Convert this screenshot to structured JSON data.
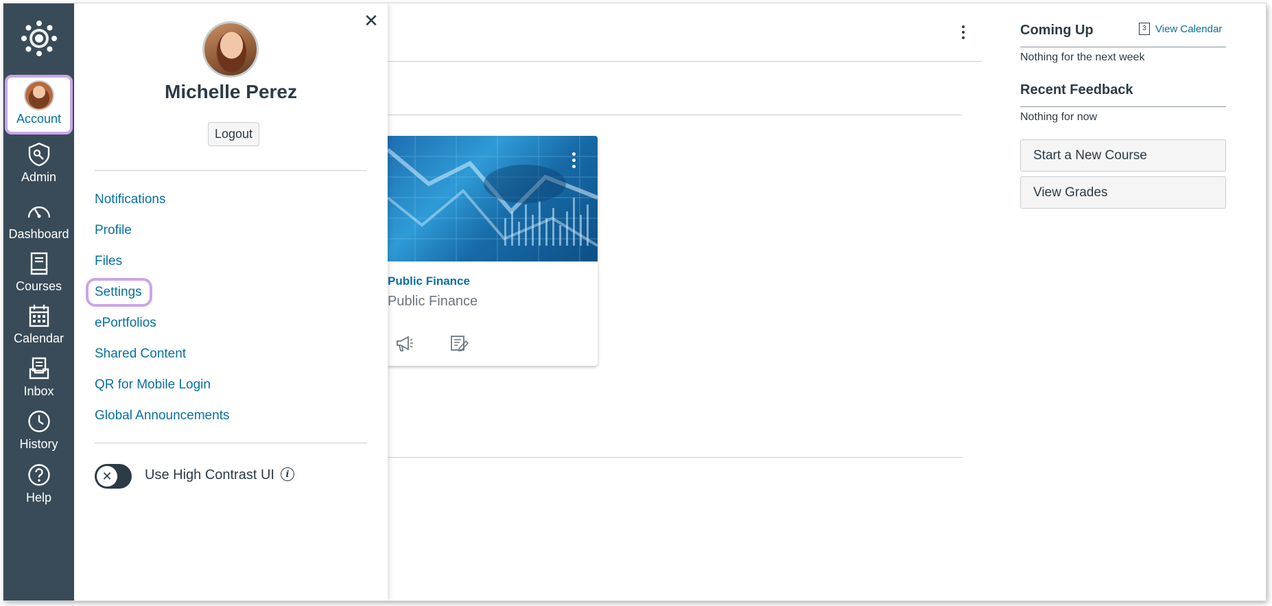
{
  "nav": {
    "account_label": "Account",
    "items": [
      {
        "label": "Admin",
        "icon": "admin-shield-icon"
      },
      {
        "label": "Dashboard",
        "icon": "dashboard-gauge-icon"
      },
      {
        "label": "Courses",
        "icon": "courses-book-icon"
      },
      {
        "label": "Calendar",
        "icon": "calendar-icon"
      },
      {
        "label": "Inbox",
        "icon": "inbox-icon"
      },
      {
        "label": "History",
        "icon": "history-clock-icon"
      },
      {
        "label": "Help",
        "icon": "help-question-icon"
      }
    ],
    "colors": {
      "background": "#394b58",
      "highlight": "#c9a6e6",
      "active_text": "#0770a3"
    }
  },
  "tray": {
    "user_name": "Michelle Perez",
    "logout_label": "Logout",
    "links": [
      "Notifications",
      "Profile",
      "Files",
      "Settings",
      "ePortfolios",
      "Shared Content",
      "QR for Mobile Login",
      "Global Announcements"
    ],
    "high_contrast_label": "Use High Contrast UI",
    "high_contrast_enabled": false
  },
  "course_card": {
    "title": "Public Finance",
    "subtitle": "Public Finance"
  },
  "sidebar": {
    "coming_up_heading": "Coming Up",
    "view_calendar_label": "View Calendar",
    "calendar_day": "3",
    "coming_up_empty": "Nothing for the next week",
    "recent_feedback_heading": "Recent Feedback",
    "recent_feedback_empty": "Nothing for now",
    "start_course_label": "Start a New Course",
    "view_grades_label": "View Grades"
  }
}
